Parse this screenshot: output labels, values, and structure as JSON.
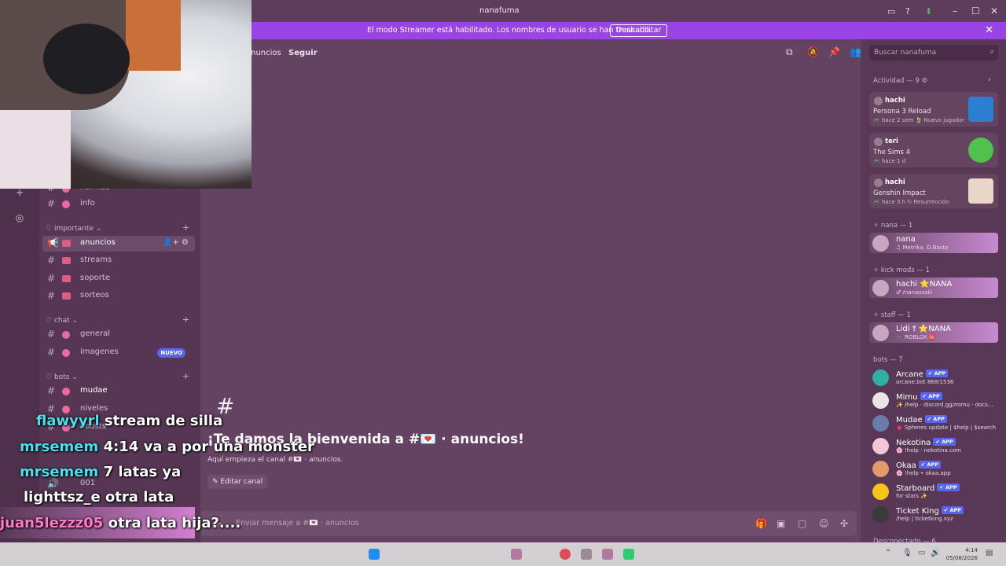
{
  "window": {
    "title": "nanafuma"
  },
  "banner": {
    "message": "El modo Streamer está habilitado. Los nombres de usuario se han truncado.",
    "button": "Deshabilitar"
  },
  "sidebar": {
    "categories": [
      {
        "label": "importante"
      },
      {
        "label": "chat"
      },
      {
        "label": "bots"
      }
    ],
    "channels": [
      {
        "name": "normas"
      },
      {
        "name": "info"
      },
      {
        "name": "anuncios"
      },
      {
        "name": "streams"
      },
      {
        "name": "soporte"
      },
      {
        "name": "sorteos"
      },
      {
        "name": "general"
      },
      {
        "name": "imagenes",
        "badge": "NUEVO"
      },
      {
        "name": "mudae"
      },
      {
        "name": "niveles"
      },
      {
        "name": "boosts"
      },
      {
        "name": "001"
      }
    ]
  },
  "header": {
    "channel": "anuncios",
    "follow": "Seguir"
  },
  "main": {
    "welcome_title": "¡Te damos la bienvenida a #💌 · anuncios!",
    "welcome_sub": "Aquí empieza el canal #💌 · anuncios.",
    "edit_button": "Editar canal"
  },
  "composer": {
    "placeholder": "Enviar mensaje a #💌 · anuncios"
  },
  "right": {
    "search_placeholder": "Buscar nanafuma",
    "activity_title": "Actividad — 9 ⚙",
    "activities": [
      {
        "user": "hachi",
        "game": "Persona 3 Reload",
        "meta": "🎮 hace 2 sem   🍃 Nuevo jugador",
        "color": "#2b7fd0"
      },
      {
        "user": "teri",
        "game": "The Sims 4",
        "meta": "🎮 hace 1 d",
        "color": "#4ec24a"
      },
      {
        "user": "hachi",
        "game": "Genshin Impact",
        "meta": "🎮 hace 3 h   ↻ Resurrección",
        "color": "#e8d6c8"
      }
    ],
    "sections": [
      {
        "title": "nana — 1"
      },
      {
        "title": "kick mods — 1"
      },
      {
        "title": "staff — 1"
      },
      {
        "title": "bots — 7"
      }
    ],
    "members_top": [
      {
        "name": "nana",
        "status": "♫ Metrika, D.Basto"
      },
      {
        "name": "hachi ⭐NANA",
        "status": "♂ /nanaosaki"
      },
      {
        "name": "Lidi † ⭐NANA",
        "status": "🎮 ROBLOX 🆑"
      }
    ],
    "bots": [
      {
        "name": "Arcane",
        "tag": "✔ APP",
        "status": "arcane.bot 868/1536"
      },
      {
        "name": "Mimu",
        "tag": "✔ APP",
        "status": "✨ /help · discord.gg/mimu · docs..."
      },
      {
        "name": "Mudae",
        "tag": "✔ APP",
        "status": "💗 Spheres update | $help | $search"
      },
      {
        "name": "Nekotina",
        "tag": "✔ APP",
        "status": "🌸 !help · nekotina.com"
      },
      {
        "name": "Okaa",
        "tag": "✔ APP",
        "status": "🌸 !help • okaa.app"
      },
      {
        "name": "Starboard",
        "tag": "✔ APP",
        "status": "for stars ✨"
      },
      {
        "name": "Ticket King",
        "tag": "✔ APP",
        "status": "/help | ticketking.xyz"
      }
    ],
    "offline_title": "Desconectado — 6"
  },
  "chat_overlay": [
    {
      "user": "flawyyrl",
      "message": "stream de silla"
    },
    {
      "user": "mrsemem",
      "message": "4:14 va a por una monster"
    },
    {
      "user": "mrsemem",
      "message": "7 latas ya"
    },
    {
      "user": "lighttsz_e",
      "message": "otra lata"
    },
    {
      "user": "juan5lezzz05",
      "message": "otra lata hija?...."
    }
  ],
  "taskbar": {
    "time": "4:14",
    "date": "05/08/2026"
  }
}
